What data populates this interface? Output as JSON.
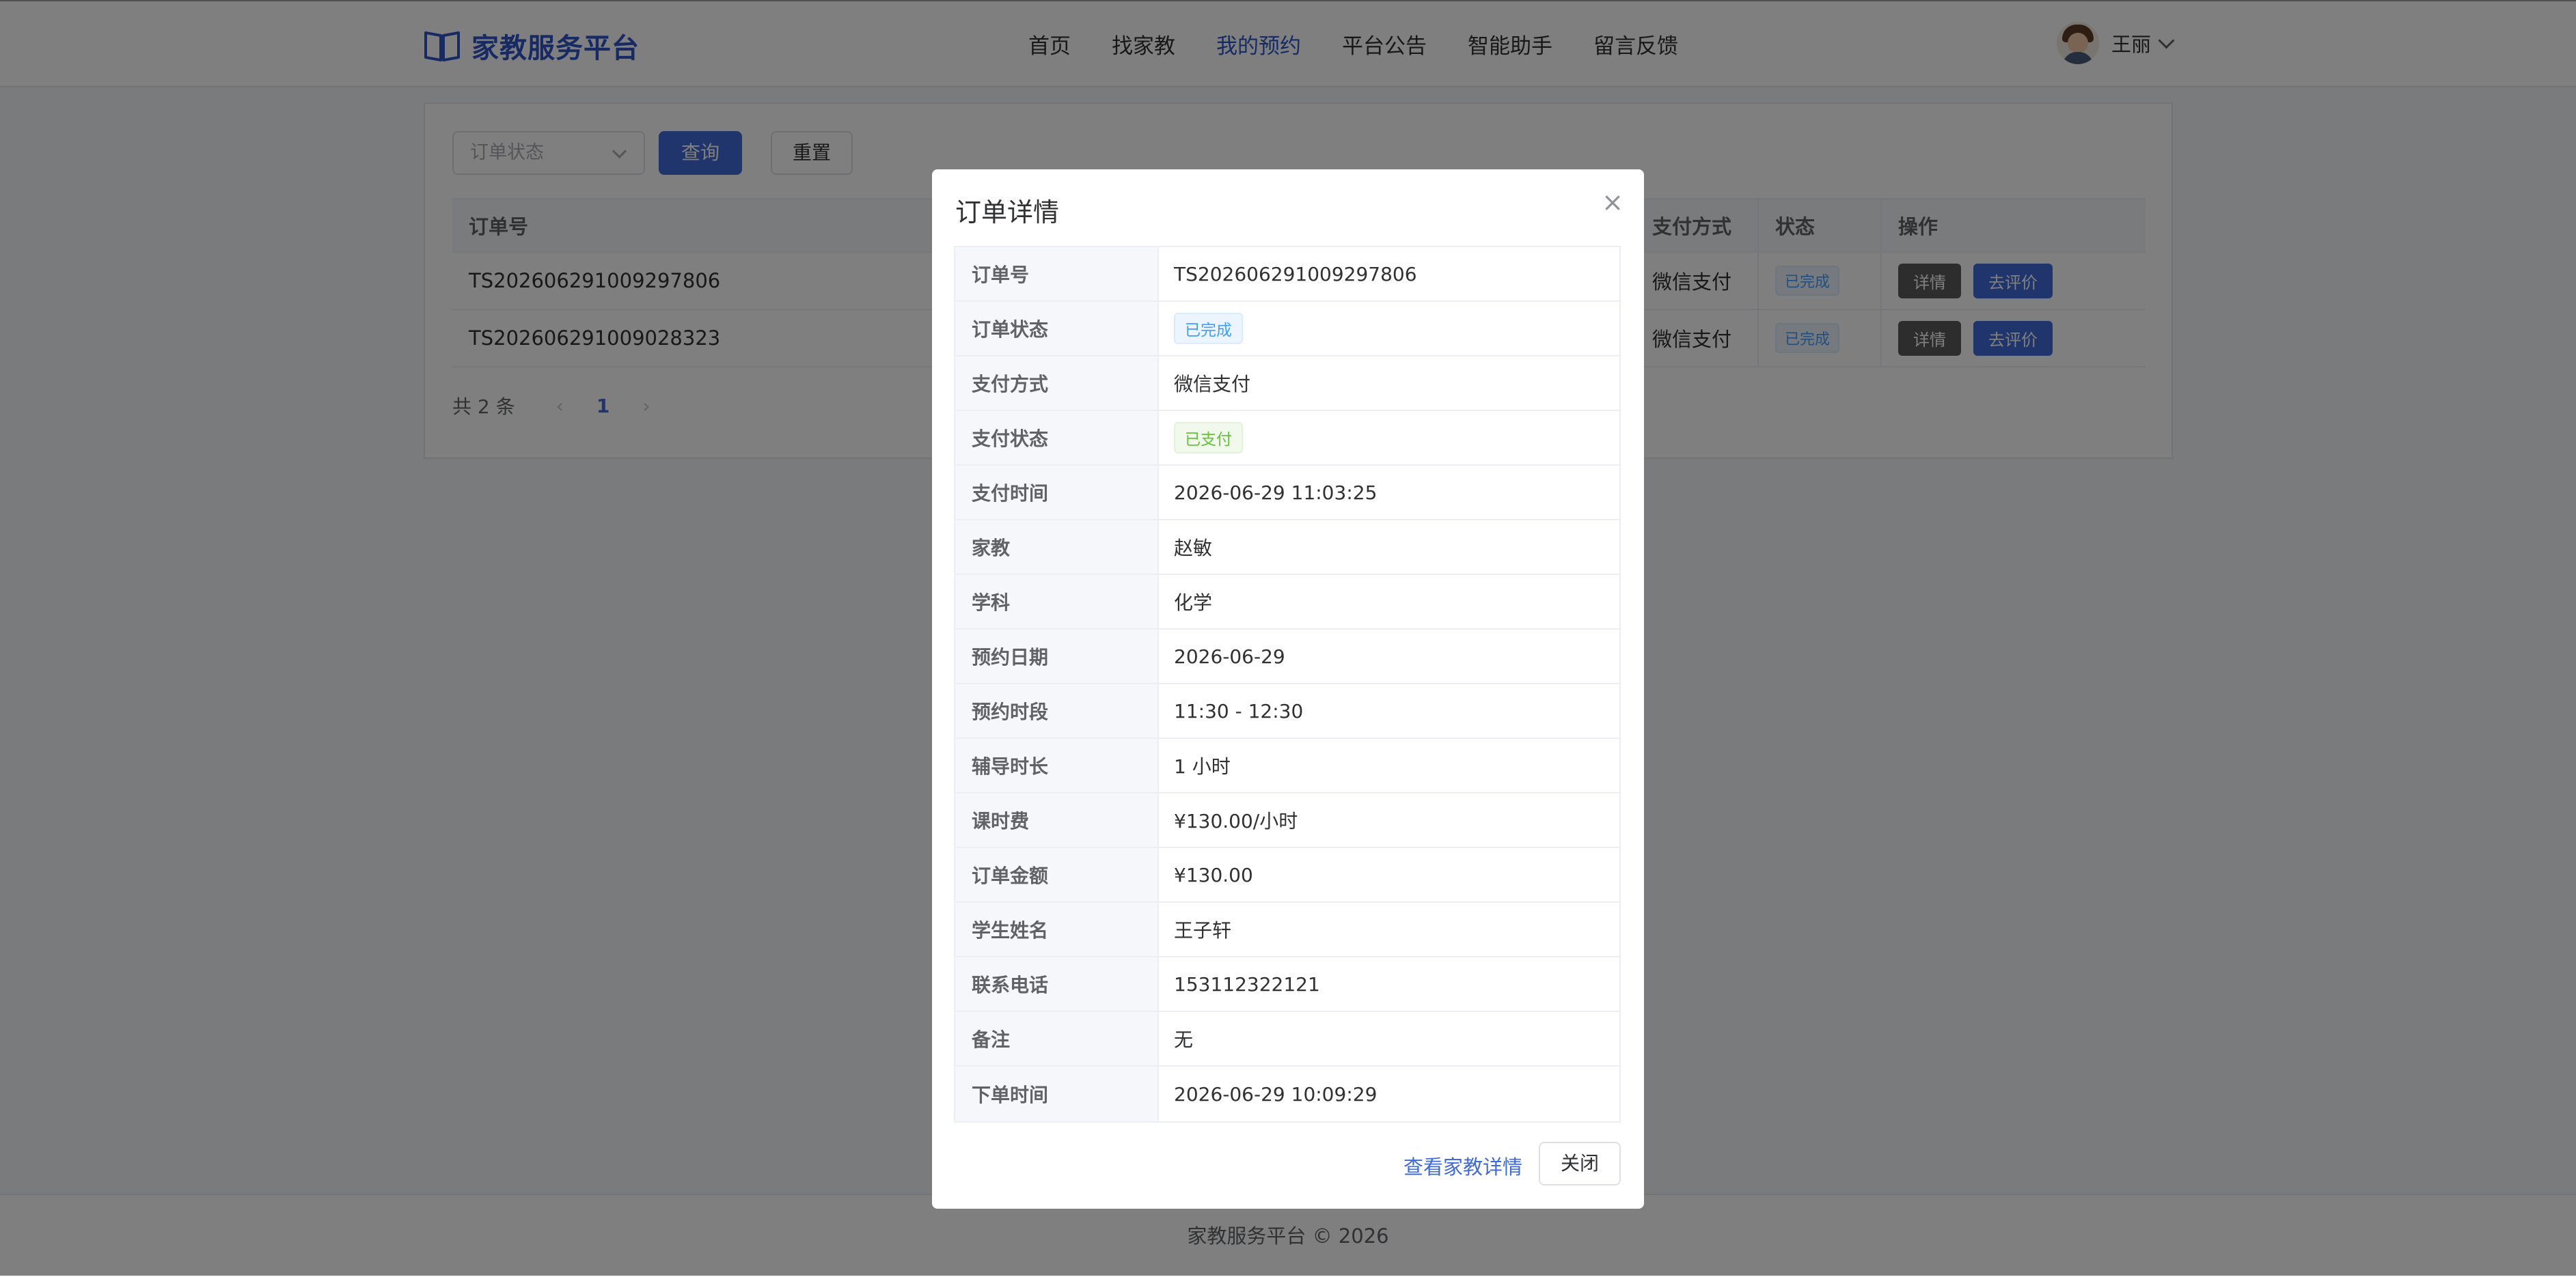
{
  "app": {
    "logo_icon": "book-icon",
    "name": "家教服务平台",
    "brand_color": "#2f54c9"
  },
  "nav": {
    "items": [
      {
        "label": "首页",
        "active": false
      },
      {
        "label": "找家教",
        "active": false
      },
      {
        "label": "我的预约",
        "active": true
      },
      {
        "label": "平台公告",
        "active": false
      },
      {
        "label": "智能助手",
        "active": false
      },
      {
        "label": "留言反馈",
        "active": false
      }
    ]
  },
  "user": {
    "name": "王丽"
  },
  "filter": {
    "status_placeholder": "订单状态",
    "query_label": "查询",
    "reset_label": "重置"
  },
  "table": {
    "headers": {
      "order_no": "订单号",
      "pay_method": "支付方式",
      "status": "状态",
      "actions": "操作"
    },
    "rows": [
      {
        "order_no": "TS20260629100929780​6",
        "pay_method": "微信支付",
        "status": "已完成",
        "detail": "详情",
        "review": "去评价"
      },
      {
        "order_no": "TS202606291009028323",
        "pay_method": "微信支付",
        "status": "已完成",
        "detail": "详情",
        "review": "去评价"
      }
    ]
  },
  "pager": {
    "total": "共 2 条",
    "prev": "‹",
    "page": "1",
    "next": "›"
  },
  "footer": {
    "text": "家教服务平台 © 2026"
  },
  "modal": {
    "title": "订单详情",
    "close_icon": "×",
    "rows": [
      {
        "label": "订单号",
        "value": "TS202606291009297806"
      },
      {
        "label": "订单状态",
        "value": "已完成",
        "tag": "blue"
      },
      {
        "label": "支付方式",
        "value": "微信支付"
      },
      {
        "label": "支付状态",
        "value": "已支付",
        "tag": "green"
      },
      {
        "label": "支付时间",
        "value": "2026-06-29 11:03:25"
      },
      {
        "label": "家教",
        "value": "赵敏"
      },
      {
        "label": "学科",
        "value": "化学"
      },
      {
        "label": "预约日期",
        "value": "2026-06-29"
      },
      {
        "label": "预约时段",
        "value": "11:30 - 12:30"
      },
      {
        "label": "辅导时长",
        "value": "1 小时"
      },
      {
        "label": "课时费",
        "value": "¥130.00/小时"
      },
      {
        "label": "订单金额",
        "value": "¥130.00"
      },
      {
        "label": "学生姓名",
        "value": "王子轩"
      },
      {
        "label": "联系电话",
        "value": "153112322121"
      },
      {
        "label": "备注",
        "value": "无"
      },
      {
        "label": "下单时间",
        "value": "2026-06-29 10:09:29"
      }
    ],
    "view_tutor_link": "查看家教详情",
    "close_button": "关闭"
  }
}
